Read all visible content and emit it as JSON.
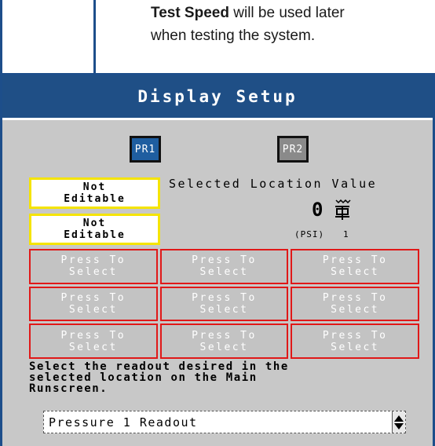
{
  "callout": {
    "bold": "Test Speed",
    "rest": " will be used later",
    "line2": "when testing the system."
  },
  "screen": {
    "title": "Display Setup",
    "pr_buttons": [
      "PR1",
      "PR2"
    ],
    "not_editable": [
      {
        "line1": "Not",
        "line2": "Editable"
      },
      {
        "line1": "Not",
        "line2": "Editable"
      }
    ],
    "selected_location_label": "Selected Location Value",
    "value": "0",
    "unit": "(PSI)",
    "location_number": "1",
    "grid_cells": [
      {
        "line1": "Press To",
        "line2": "Select"
      },
      {
        "line1": "Press To",
        "line2": "Select"
      },
      {
        "line1": "Press To",
        "line2": "Select"
      },
      {
        "line1": "Press To",
        "line2": "Select"
      },
      {
        "line1": "Press To",
        "line2": "Select"
      },
      {
        "line1": "Press To",
        "line2": "Select"
      },
      {
        "line1": "Press To",
        "line2": "Select"
      },
      {
        "line1": "Press To",
        "line2": "Select"
      },
      {
        "line1": "Press To",
        "line2": "Select"
      }
    ],
    "instruction_lines": [
      "Select the readout desired in the",
      "selected location on the Main",
      "Runscreen."
    ],
    "dropdown_value": "Pressure 1 Readout",
    "sensor_icon": "pressure-sensor-icon",
    "colors": {
      "title_bar": "#1f4f86",
      "pr1_active": "#1f5ea0",
      "pr2_inactive": "#8a8a8a",
      "not_editable_border": "#f5e400",
      "cell_border": "#e01818"
    }
  }
}
